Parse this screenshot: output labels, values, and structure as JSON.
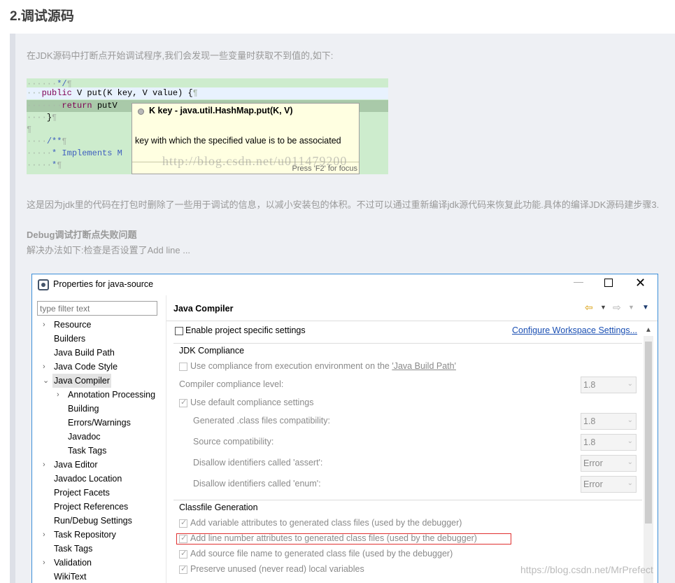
{
  "article": {
    "heading": "2.调试源码",
    "intro": "在JDK源码中打断点开始调试程序,我们会发现一些变量时获取不到值的,如下:",
    "para1": "这是因为jdk里的代码在打包时删除了一些用于调试的信息，以减小安装包的体积。不过可以通过重新编译jdk源代码来恢复此功能.具体的编译JDK源码建步骤3.",
    "para2": "Debug调试打断点失败问题",
    "para3": "解决办法如下:检查是否设置了Add line ...",
    "watermark_bottom": "https://blog.csdn.net/MrPrefect"
  },
  "code": {
    "l1_dots": "······",
    "l1_code": "*/",
    "l2_dots": "···",
    "l2_kw": "public",
    "l2_code": " V put(K key, V value) {",
    "l3_dots": "·······",
    "l3_kw": "return",
    "l3_code": " putV",
    "l4_dots": "····",
    "l4_code": "}",
    "l6_dots": "····",
    "l6_code": "/**",
    "l7_dots": "·····",
    "l7_code": "* Implements M",
    "l8_dots": "·····",
    "l8_code": "*",
    "pilcrow": "¶",
    "tooltip_title": "K key - java.util.HashMap.put(K, V)",
    "tooltip_desc": "key with which the specified value is to be associated",
    "tooltip_focus": "Press 'F2' for focus",
    "watermark": "http://blog.csdn.net/u011479200"
  },
  "dialog": {
    "title": "Properties for java-source",
    "filter_placeholder": "type filter text",
    "tree": [
      {
        "label": "Resource",
        "arrow": "›"
      },
      {
        "label": "Builders",
        "arrow": ""
      },
      {
        "label": "Java Build Path",
        "arrow": ""
      },
      {
        "label": "Java Code Style",
        "arrow": "›"
      },
      {
        "label": "Java Compiler",
        "arrow": "⌄"
      },
      {
        "label": "Annotation Processing",
        "arrow": "›"
      },
      {
        "label": "Building",
        "arrow": ""
      },
      {
        "label": "Errors/Warnings",
        "arrow": ""
      },
      {
        "label": "Javadoc",
        "arrow": ""
      },
      {
        "label": "Task Tags",
        "arrow": ""
      },
      {
        "label": "Java Editor",
        "arrow": "›"
      },
      {
        "label": "Javadoc Location",
        "arrow": ""
      },
      {
        "label": "Project Facets",
        "arrow": ""
      },
      {
        "label": "Project References",
        "arrow": ""
      },
      {
        "label": "Run/Debug Settings",
        "arrow": ""
      },
      {
        "label": "Task Repository",
        "arrow": "›"
      },
      {
        "label": "Task Tags",
        "arrow": ""
      },
      {
        "label": "Validation",
        "arrow": "›"
      },
      {
        "label": "WikiText",
        "arrow": ""
      }
    ],
    "pane_title": "Java Compiler",
    "enable_specific": "Enable project specific settings",
    "configure_link": "Configure Workspace Settings...",
    "jdk_group": "JDK Compliance",
    "use_compliance_prefix": "Use compliance from execution environment on the ",
    "use_compliance_link": "'Java Build Path'",
    "compliance_level_label": "Compiler compliance level:",
    "compliance_level_value": "1.8",
    "use_default_compliance": "Use default compliance settings",
    "generated_compat_label": "Generated .class files compatibility:",
    "generated_compat_value": "1.8",
    "source_compat_label": "Source compatibility:",
    "source_compat_value": "1.8",
    "assert_label": "Disallow identifiers called 'assert':",
    "assert_value": "Error",
    "enum_label": "Disallow identifiers called 'enum':",
    "enum_value": "Error",
    "classfile_group": "Classfile Generation",
    "opt_variable": "Add variable attributes to generated class files (used by the debugger)",
    "opt_line": "Add line number attributes to generated class files (used by the debugger)",
    "opt_source": "Add source file name to generated class file (used by the debugger)",
    "opt_preserve": "Preserve unused (never read) local variables"
  }
}
